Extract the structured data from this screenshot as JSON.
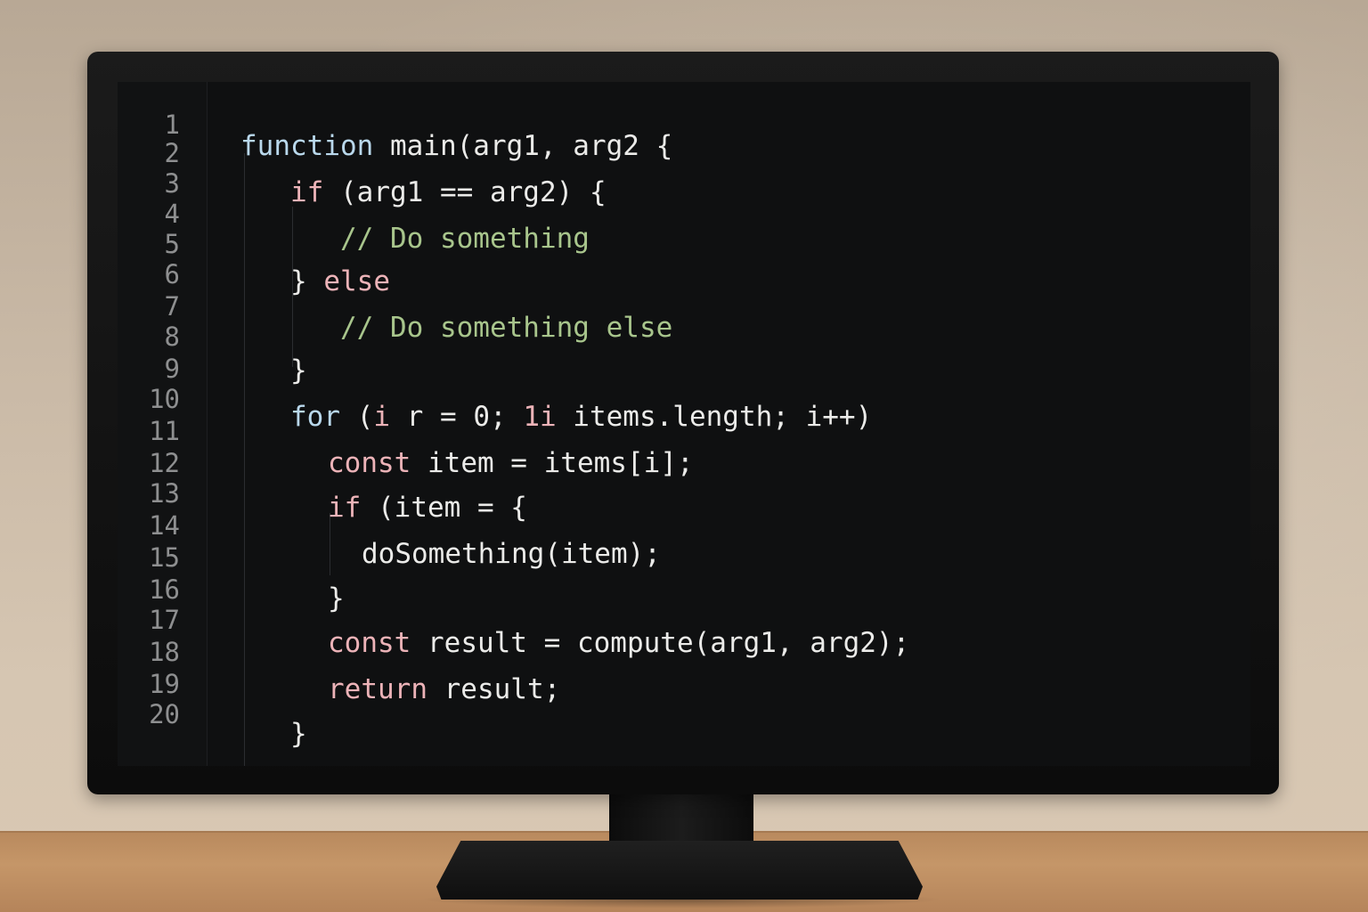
{
  "editor": {
    "line_numbers": [
      "1",
      "2",
      "3",
      "4",
      "5",
      "6",
      "7",
      "8",
      "9",
      "10",
      "11",
      "12",
      "13",
      "14",
      "15",
      "16",
      "17",
      "18",
      "19",
      "20"
    ],
    "code_lines": [
      {
        "tokens": [
          {
            "text": "function",
            "kind": "kw-blue"
          },
          {
            "text": " main(arg1, arg2 {",
            "kind": "plain"
          }
        ]
      },
      {
        "tokens": [
          {
            "text": "if",
            "kind": "kw"
          },
          {
            "text": " (arg1 == arg2) {",
            "kind": "plain"
          }
        ]
      },
      {
        "tokens": [
          {
            "text": "// Do something",
            "kind": "comment"
          }
        ]
      },
      {
        "tokens": [
          {
            "text": "} ",
            "kind": "plain"
          },
          {
            "text": "else",
            "kind": "kw"
          }
        ]
      },
      {
        "tokens": [
          {
            "text": "// Do something else",
            "kind": "comment"
          }
        ]
      },
      {
        "tokens": [
          {
            "text": "}",
            "kind": "plain"
          }
        ]
      },
      {
        "tokens": [
          {
            "text": "for",
            "kind": "kw-blue"
          },
          {
            "text": " (",
            "kind": "plain"
          },
          {
            "text": "i",
            "kind": "kw"
          },
          {
            "text": " r = 0; ",
            "kind": "plain"
          },
          {
            "text": "1i",
            "kind": "kw"
          },
          {
            "text": " items.length; i++)",
            "kind": "plain"
          }
        ]
      },
      {
        "tokens": [
          {
            "text": "const",
            "kind": "kw"
          },
          {
            "text": " item = items[i];",
            "kind": "plain"
          }
        ]
      },
      {
        "tokens": [
          {
            "text": "if",
            "kind": "kw"
          },
          {
            "text": " (item = {",
            "kind": "plain"
          }
        ]
      },
      {
        "tokens": [
          {
            "text": "doSomething(item);",
            "kind": "plain"
          }
        ]
      },
      {
        "tokens": [
          {
            "text": "}",
            "kind": "plain"
          }
        ]
      },
      {
        "tokens": [
          {
            "text": "const",
            "kind": "kw"
          },
          {
            "text": " result = compute(arg1, arg2);",
            "kind": "plain"
          }
        ]
      },
      {
        "tokens": [
          {
            "text": "return",
            "kind": "kw"
          },
          {
            "text": " result;",
            "kind": "plain"
          }
        ]
      },
      {
        "tokens": [
          {
            "text": "}",
            "kind": "plain"
          }
        ]
      }
    ]
  },
  "colors": {
    "screen_background": "#0f1011",
    "keyword_pink": "#ecb3b8",
    "keyword_blue": "#b9d8ec",
    "comment_green": "#a8c58c",
    "plain_text": "#ebebe9",
    "line_number": "#8e8f90"
  }
}
